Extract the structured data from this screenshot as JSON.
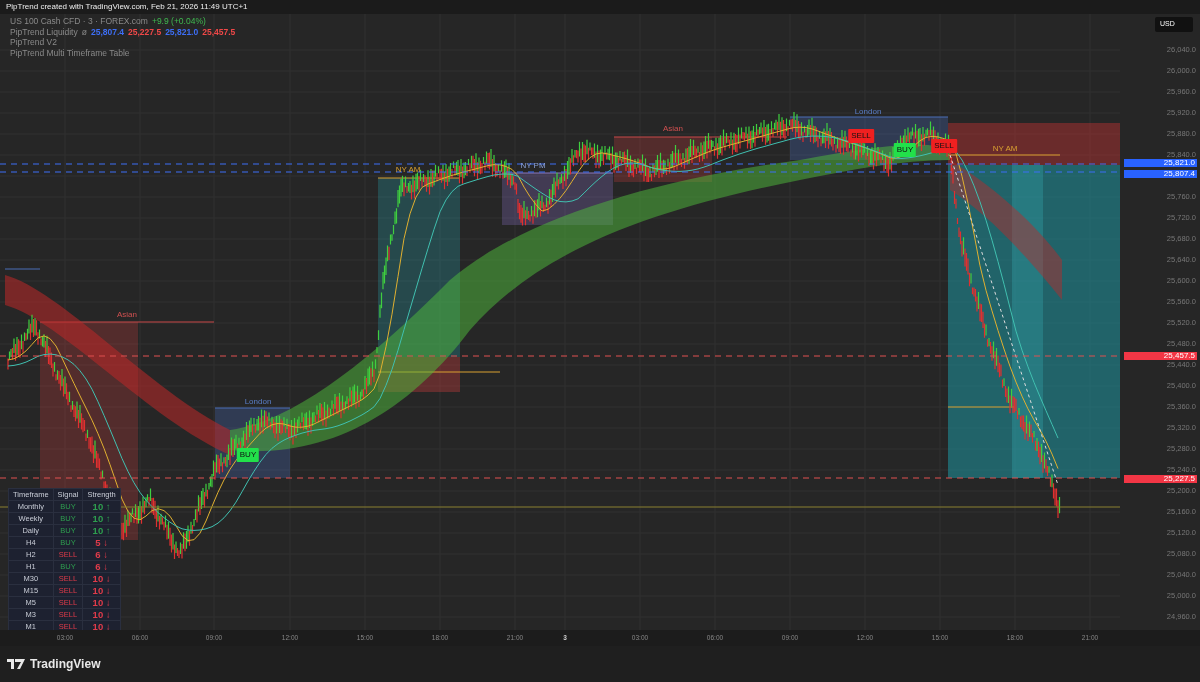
{
  "header": {
    "title": "PipTrend created with TradingView.com, Feb 21, 2026 11:49 UTC+1"
  },
  "legend": {
    "symbol": "US 100 Cash CFD · 3 · FOREX.com",
    "change": "+9.9 (+0.04%)",
    "indicators": [
      {
        "name": "PipTrend Liquidity",
        "symbol": "ø",
        "values": [
          {
            "text": "25,807.4",
            "color": "#3d6ef5"
          },
          {
            "text": "25,227.5",
            "color": "#f04848"
          },
          {
            "text": "25,821.0",
            "color": "#3d6ef5"
          },
          {
            "text": "25,457.5",
            "color": "#f04848"
          }
        ]
      },
      {
        "name": "PipTrend V2"
      },
      {
        "name": "PipTrend Multi Timeframe Table"
      }
    ]
  },
  "currency": "USD",
  "price_axis": [
    "26,040.0",
    "26,000.0",
    "25,960.0",
    "25,920.0",
    "25,880.0",
    "25,840.0",
    "25,760.0",
    "25,720.0",
    "25,680.0",
    "25,640.0",
    "25,600.0",
    "25,560.0",
    "25,520.0",
    "25,480.0",
    "25,440.0",
    "25,400.0",
    "25,360.0",
    "25,320.0",
    "25,280.0",
    "25,240.0",
    "25,200.0",
    "25,160.0",
    "25,120.0",
    "25,080.0",
    "25,040.0",
    "25,000.0",
    "24,960.0"
  ],
  "price_markers": [
    {
      "text": "25,821.0",
      "color": "#2962ff"
    },
    {
      "text": "25,807.4",
      "color": "#2962ff"
    },
    {
      "text": "25,457.5",
      "color": "#f23645"
    },
    {
      "text": "25,227.5",
      "color": "#f23645"
    }
  ],
  "time_axis": [
    "03:00",
    "06:00",
    "09:00",
    "12:00",
    "15:00",
    "18:00",
    "21:00",
    "3",
    "03:00",
    "06:00",
    "09:00",
    "12:00",
    "15:00",
    "18:00",
    "21:00"
  ],
  "sessions": [
    {
      "label": "Asian",
      "kind": "asian"
    },
    {
      "label": "London",
      "kind": "london"
    },
    {
      "label": "NY AM",
      "kind": "nyam"
    },
    {
      "label": "NY PM",
      "kind": "nypm"
    },
    {
      "label": "Asian",
      "kind": "asian"
    },
    {
      "label": "London",
      "kind": "london"
    },
    {
      "label": "NY AM",
      "kind": "nyam"
    }
  ],
  "signals": [
    {
      "label": "BUY",
      "kind": "buy"
    },
    {
      "label": "SELL",
      "kind": "sell"
    },
    {
      "label": "BUY",
      "kind": "buy"
    },
    {
      "label": "SELL",
      "kind": "sell"
    }
  ],
  "mtf_table": {
    "columns": [
      "Timeframe",
      "Signal",
      "Strength"
    ],
    "rows": [
      {
        "timeframe": "Monthly",
        "signal": "BUY",
        "kind": "buy",
        "strength": {
          "text": "10 ↑",
          "color": "#2e9e4f"
        }
      },
      {
        "timeframe": "Weekly",
        "signal": "BUY",
        "kind": "buy",
        "strength": {
          "text": "10 ↑",
          "color": "#2e9e4f"
        }
      },
      {
        "timeframe": "Daily",
        "signal": "BUY",
        "kind": "buy",
        "strength": {
          "text": "10 ↑",
          "color": "#2e9e4f"
        }
      },
      {
        "timeframe": "H4",
        "signal": "BUY",
        "kind": "buy",
        "strength": {
          "text": "5 ↓",
          "color": "#e03b4a"
        }
      },
      {
        "timeframe": "H2",
        "signal": "SELL",
        "kind": "sell",
        "strength": {
          "text": "6 ↓",
          "color": "#e03b4a"
        }
      },
      {
        "timeframe": "H1",
        "signal": "BUY",
        "kind": "buy",
        "strength": {
          "text": "6 ↓",
          "color": "#e03b4a"
        }
      },
      {
        "timeframe": "M30",
        "signal": "SELL",
        "kind": "sell",
        "strength": {
          "text": "10 ↓",
          "color": "#e03b4a"
        }
      },
      {
        "timeframe": "M15",
        "signal": "SELL",
        "kind": "sell",
        "strength": {
          "text": "10 ↓",
          "color": "#e03b4a"
        }
      },
      {
        "timeframe": "M5",
        "signal": "SELL",
        "kind": "sell",
        "strength": {
          "text": "10 ↓",
          "color": "#e03b4a"
        }
      },
      {
        "timeframe": "M3",
        "signal": "SELL",
        "kind": "sell",
        "strength": {
          "text": "10 ↓",
          "color": "#e03b4a"
        }
      },
      {
        "timeframe": "M1",
        "signal": "SELL",
        "kind": "sell",
        "strength": {
          "text": "10 ↓",
          "color": "#e03b4a"
        }
      }
    ]
  },
  "footer": {
    "brand": "TradingView"
  }
}
